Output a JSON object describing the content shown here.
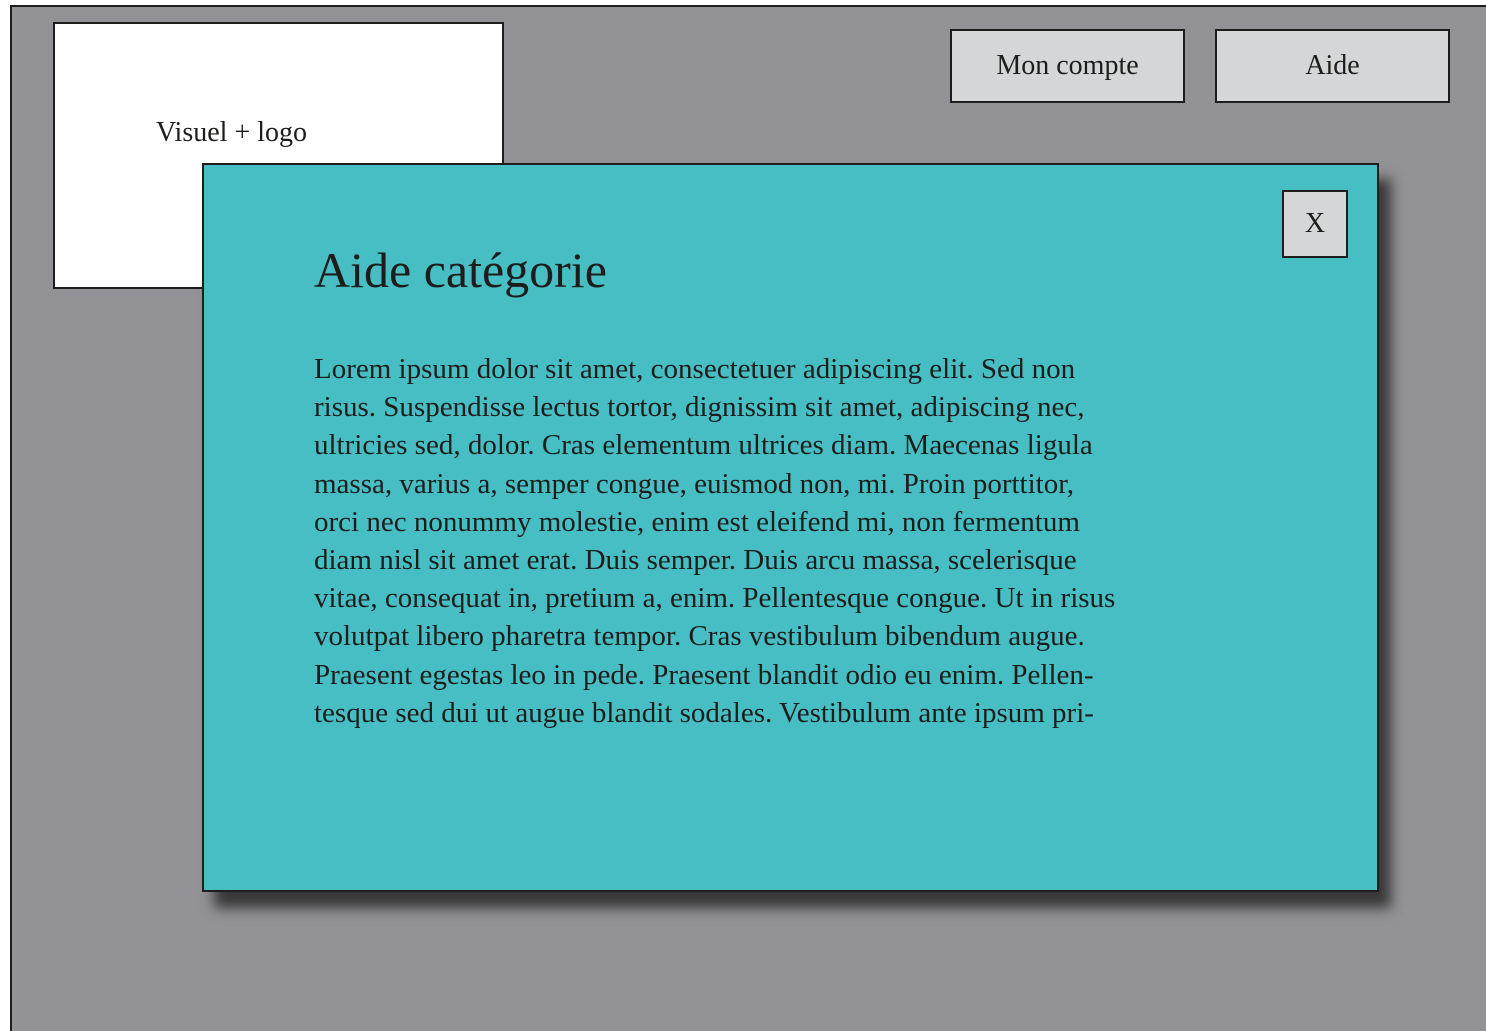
{
  "header": {
    "logo_label": "Visuel + logo",
    "account_button": "Mon compte",
    "help_button": "Aide"
  },
  "modal": {
    "title": "Aide catégorie",
    "close_label": "X",
    "body_lines": [
      "Lorem ipsum dolor sit amet, consectetuer adipiscing elit. Sed non",
      "risus. Suspendisse lectus tortor, dignissim sit amet, adipiscing nec,",
      "ultricies sed, dolor. Cras elementum ultrices diam. Maecenas ligula",
      "massa, varius a, semper congue, euismod non, mi. Proin porttitor,",
      "orci nec nonummy molestie, enim est eleifend mi, non fermentum",
      "diam nisl sit amet erat. Duis semper. Duis arcu massa, scelerisque",
      "vitae, consequat in, pretium a, enim. Pellentesque congue. Ut in risus",
      "volutpat libero pharetra tempor. Cras vestibulum bibendum augue.",
      "Praesent egestas leo in pede. Praesent blandit odio eu enim. Pellen-",
      "tesque sed dui ut augue blandit sodales. Vestibulum ante ipsum pri-"
    ]
  },
  "colors": {
    "page_background": "#939397",
    "modal_background": "#46bec4",
    "button_background": "#d5d6d8",
    "text": "#1d1d1b"
  }
}
